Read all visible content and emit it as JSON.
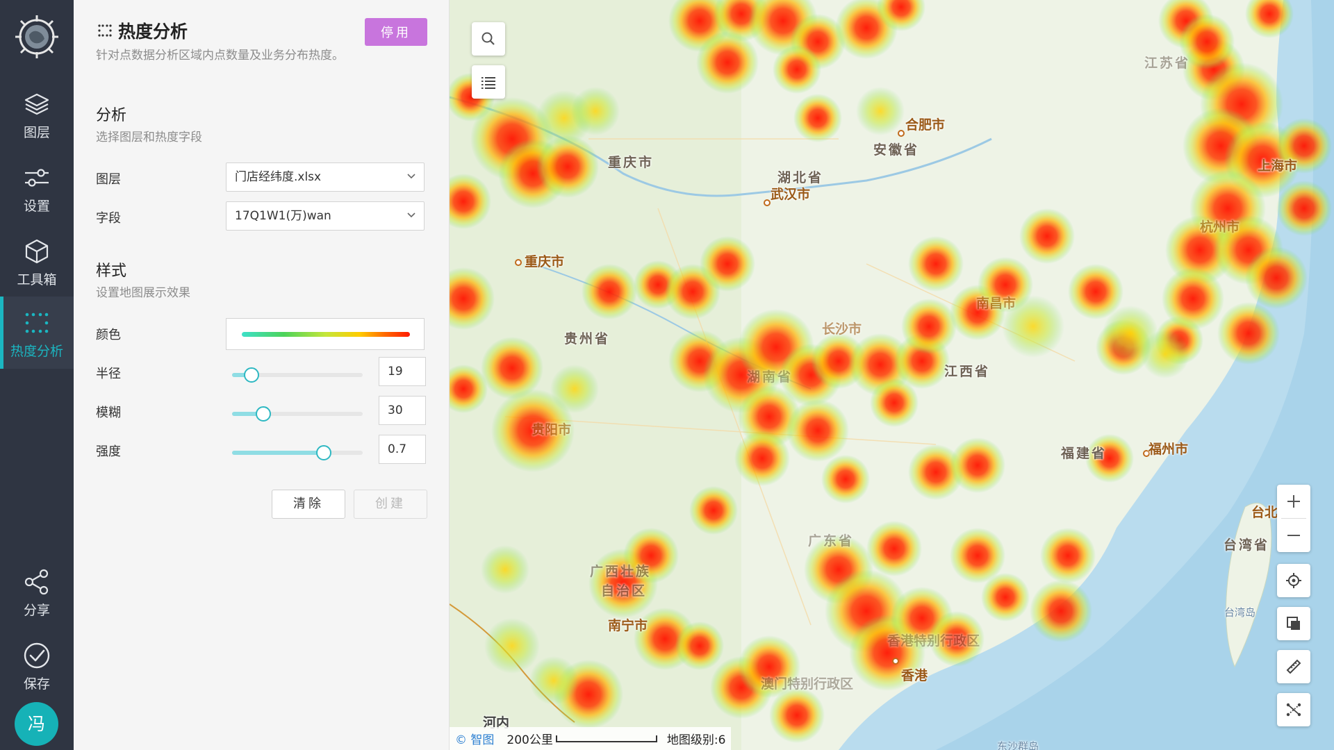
{
  "sidebar": {
    "items": [
      {
        "label": "图层",
        "icon": "layers-icon"
      },
      {
        "label": "设置",
        "icon": "sliders-icon"
      },
      {
        "label": "工具箱",
        "icon": "cube-icon"
      },
      {
        "label": "热度分析",
        "icon": "dots-grid-icon",
        "active": true
      },
      {
        "label": "分享",
        "icon": "share-icon"
      },
      {
        "label": "保存",
        "icon": "check-circle-icon"
      }
    ],
    "avatar": "冯"
  },
  "panel": {
    "title": "热度分析",
    "disable_button": "停用",
    "description": "针对点数据分析区域内点数量及业务分布热度。",
    "analysis": {
      "heading": "分析",
      "subheading": "选择图层和热度字段",
      "layer_label": "图层",
      "layer_value": "门店经纬度.xlsx",
      "field_label": "字段",
      "field_value": "17Q1W1(万)wan"
    },
    "style": {
      "heading": "样式",
      "subheading": "设置地图展示效果",
      "color_label": "颜色",
      "color_gradient": [
        "#3ee0c9",
        "#4cd35a",
        "#c5e63a",
        "#ffcc00",
        "#ff6a00",
        "#ff1a00"
      ],
      "radius_label": "半径",
      "radius_value": "19",
      "radius_fraction": 0.15,
      "blur_label": "模糊",
      "blur_value": "30",
      "blur_fraction": 0.24,
      "intensity_label": "强度",
      "intensity_value": "0.7",
      "intensity_fraction": 0.7
    },
    "clear_button": "清除",
    "create_button": "创建"
  },
  "map": {
    "labels": {
      "chongqing_region": "重庆市",
      "hubei": "湖北省",
      "hefei": "合肥市",
      "anhui": "安徽省",
      "wuhan": "武汉市",
      "shanghai": "上海市",
      "jiangsu": "江苏省",
      "hangzhou": "杭州市",
      "chongqing_city": "重庆市",
      "guizhou": "贵州省",
      "nanchang": "南昌市",
      "changsha": "长沙市",
      "hunan": "湖南省",
      "jiangxi": "江西省",
      "guiyang": "贵阳市",
      "fujian": "福建省",
      "fuzhou": "福州市",
      "taibei": "台北",
      "taiwan": "台湾省",
      "taiwan_island": "台湾岛",
      "guangdong": "广东省",
      "guangxi1": "广西壮族",
      "guangxi2": "自治区",
      "nanning": "南宁市",
      "hk_sar": "香港特别行政区",
      "hongkong": "香港",
      "macau_sar": "澳门特别行政区",
      "hanoi": "河内",
      "dongsha": "东沙群岛"
    },
    "attribution": "智图",
    "scale_label": "200公里",
    "zoom_level": "地图级别:6",
    "tools": [
      "search-icon",
      "list-icon",
      "zoom-in-icon",
      "zoom-out-icon",
      "locate-icon",
      "layers-switch-icon",
      "ruler-icon",
      "route-icon"
    ]
  }
}
